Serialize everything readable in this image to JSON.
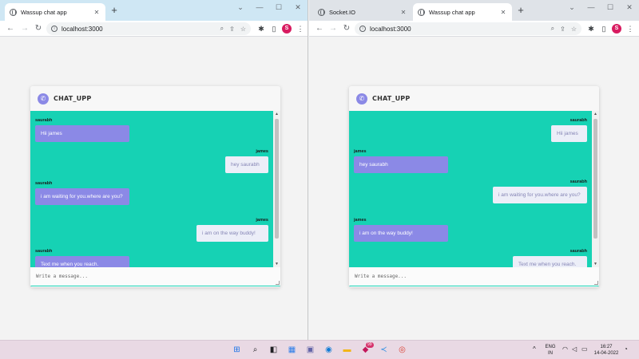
{
  "windows": [
    {
      "tabs": [
        {
          "label": "Wassup chat app",
          "close": "✕"
        }
      ],
      "new_tab": "+",
      "controls": {
        "minimize": "⌄",
        "restore": "—",
        "maximize": "☐",
        "close": "✕"
      },
      "address": {
        "url": "localhost:3000"
      },
      "profile_initial": "S",
      "chat": {
        "title": "CHAT_UPP",
        "placeholder": "Write a message...",
        "messages": [
          {
            "sender": "saurabh",
            "text": "Hii james",
            "side": "incoming"
          },
          {
            "sender": "james",
            "text": "hey saurabh",
            "side": "outgoing"
          },
          {
            "sender": "saurabh",
            "text": "i am waiting for you.where are you?",
            "side": "incoming"
          },
          {
            "sender": "james",
            "text": "i am on the way buddy!",
            "side": "outgoing"
          },
          {
            "sender": "saurabh",
            "text": "Text me when you reach.",
            "side": "incoming"
          }
        ]
      }
    },
    {
      "tabs": [
        {
          "label": "Socket.IO",
          "close": "✕"
        },
        {
          "label": "Wassup chat app",
          "close": "✕"
        }
      ],
      "new_tab": "+",
      "controls": {
        "minimize": "⌄",
        "restore": "—",
        "maximize": "☐",
        "close": "✕"
      },
      "address": {
        "url": "localhost:3000"
      },
      "profile_initial": "S",
      "chat": {
        "title": "CHAT_UPP",
        "placeholder": "Write a message...",
        "messages": [
          {
            "sender": "saurabh",
            "text": "Hii james",
            "side": "outgoing"
          },
          {
            "sender": "james",
            "text": "hey saurabh",
            "side": "incoming"
          },
          {
            "sender": "saurabh",
            "text": "i am waiting for you.where are you?",
            "side": "outgoing"
          },
          {
            "sender": "james",
            "text": "i am on the way buddy!",
            "side": "incoming"
          },
          {
            "sender": "saurabh",
            "text": "Text me when you reach.",
            "side": "outgoing"
          }
        ]
      }
    }
  ],
  "taskbar": {
    "badge": "99",
    "language": "ENG",
    "region": "IN",
    "time": "16:27",
    "date": "14-04-2022"
  },
  "colors": {
    "chat_bg": "#16d2b4",
    "incoming_bubble": "#8b89e6",
    "outgoing_bubble": "#eceef8",
    "profile": "#d81b60"
  }
}
